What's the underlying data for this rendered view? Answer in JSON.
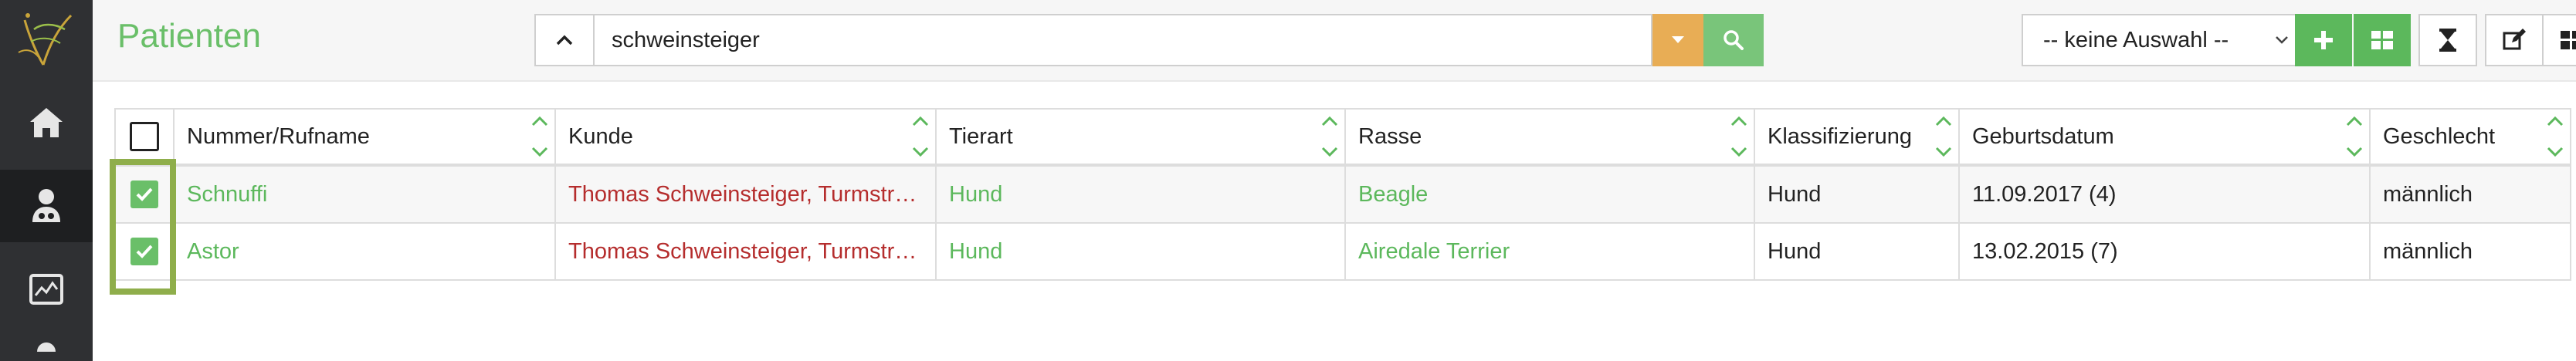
{
  "header": {
    "title": "Patienten",
    "search_value": "schweinsteiger",
    "filter_select": "-- keine Auswahl --"
  },
  "sidebar": {
    "items": [
      {
        "icon": "home-icon"
      },
      {
        "icon": "patient-icon",
        "active": true
      },
      {
        "icon": "monitor-chart-icon"
      }
    ]
  },
  "colors": {
    "accent_green": "#5cb85c",
    "title_green": "#6abf69",
    "warning_orange": "#e8ad55",
    "danger_red": "#d9534f",
    "link_red": "#b52d2d",
    "highlight_olive": "#8fae4b"
  },
  "table": {
    "columns": [
      "Nummer/Rufname",
      "Kunde",
      "Tierart",
      "Rasse",
      "Klassifizierung",
      "Geburtsdatum",
      "Geschlecht"
    ],
    "rows": [
      {
        "checked": true,
        "name": "Schnuffi",
        "kunde": "Thomas Schweinsteiger, Turmstraße",
        "tierart": "Hund",
        "rasse": "Beagle",
        "klassifizierung": "Hund",
        "geburtsdatum": "11.09.2017 (4)",
        "geschlecht": "männlich"
      },
      {
        "checked": true,
        "name": "Astor",
        "kunde": "Thomas Schweinsteiger, Turmstraße",
        "tierart": "Hund",
        "rasse": "Airedale Terrier",
        "klassifizierung": "Hund",
        "geburtsdatum": "13.02.2015 (7)",
        "geschlecht": "männlich"
      }
    ]
  }
}
